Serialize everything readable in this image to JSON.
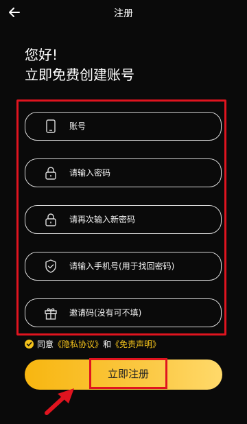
{
  "header": {
    "title": "注册",
    "back_icon": "arrow-left-icon"
  },
  "greeting": "您好!",
  "subtitle": "立即免费创建账号",
  "form": {
    "fields": [
      {
        "placeholder": "账号",
        "icon": "phone-icon"
      },
      {
        "placeholder": "请输入密码",
        "icon": "lock-icon"
      },
      {
        "placeholder": "请再次输入新密码",
        "icon": "lock-icon"
      },
      {
        "placeholder": "请输入手机号(用于找回密码)",
        "icon": "shield-check-icon"
      },
      {
        "placeholder": "邀请码(没有可不填)",
        "icon": "gift-icon"
      }
    ]
  },
  "agreement": {
    "prefix": "同意",
    "privacy_link": "《隐私协议》",
    "and": "和",
    "disclaimer_link": "《免责声明》",
    "checked": true
  },
  "register_button": {
    "label": "立即注册"
  },
  "colors": {
    "accent": "#f4c21b",
    "highlight": "#e0141f",
    "background": "#0a0a0a"
  }
}
